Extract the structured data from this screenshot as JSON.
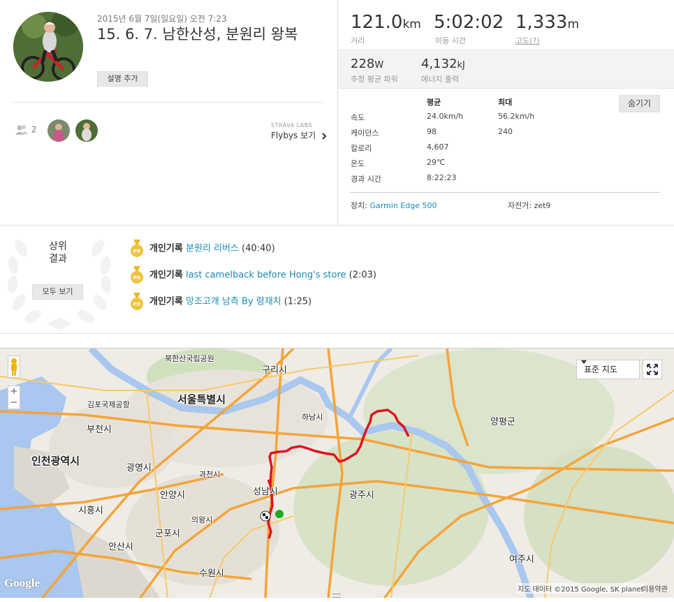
{
  "activity": {
    "date": "2015년 6월 7일(일요일) 오전 7:23",
    "title": "15. 6. 7. 남한산성, 분원리 왕복",
    "add_description": "설명 추가",
    "kudos_count": "2",
    "flybys_lab": "STRAVA LABS",
    "flybys_label": "Flybys 보기"
  },
  "stats": {
    "distance_value": "121.0",
    "distance_unit": "km",
    "distance_label": "거리",
    "moving_time_value": "5:02:02",
    "moving_time_label": "이동 시간",
    "elevation_value": "1,333",
    "elevation_unit": "m",
    "elevation_label": "고도(?)",
    "power_value": "228",
    "power_unit": "W",
    "power_label": "추정 평균 파워",
    "energy_value": "4,132",
    "energy_unit": "kJ",
    "energy_label": "에너지 출력"
  },
  "details": {
    "col_avg": "평균",
    "col_max": "최대",
    "hide_button": "숨기기",
    "rows": [
      {
        "label": "속도",
        "avg": "24.0km/h",
        "max": "56.2km/h"
      },
      {
        "label": "케이던스",
        "avg": "98",
        "max": "240"
      },
      {
        "label": "칼로리",
        "avg": "4,607",
        "max": ""
      },
      {
        "label": "온도",
        "avg": "29℃",
        "max": ""
      },
      {
        "label": "경과 시간",
        "avg": "8:22:23",
        "max": ""
      }
    ],
    "device_label": "장치:",
    "device_value": "Garmin Edge 500",
    "bike_label": "자전거:",
    "bike_value": "zet9"
  },
  "results": {
    "heading_line1": "상위",
    "heading_line2": "결과",
    "see_all": "모두 보기",
    "items": [
      {
        "badge": "PR",
        "prefix": "개인기록",
        "segment": "분원리 리버스",
        "time": "(40:40)"
      },
      {
        "badge": "PR",
        "prefix": "개인기록",
        "segment": "last camelback before Hong's store",
        "time": "(2:03)"
      },
      {
        "badge": "PR",
        "prefix": "개인기록",
        "segment": "망조고개 남측 By 령재치",
        "time": "(1:25)"
      }
    ]
  },
  "map": {
    "map_type": "표준 지도",
    "zoom_in": "+",
    "zoom_out": "−",
    "logo": "Google",
    "copyright": "지도 데이터 ©2015 Google, SK planet",
    "terms": "이용약관",
    "labels": {
      "park": "북한산국립공원",
      "guri": "구리시",
      "seoul": "서울특별시",
      "gimpo": "김포국제공항",
      "bucheon": "부천시",
      "incheon": "인천광역시",
      "hanam": "하남시",
      "yangpyeong": "양평군",
      "gwangmyeong": "광명시",
      "gwacheon": "과천시",
      "seongnam": "성남시",
      "gwangju": "광주시",
      "anyang": "안양시",
      "siheung": "시흥시",
      "uiwang": "의왕시",
      "gunpo": "군포시",
      "ansan": "안산시",
      "suwon": "수원시",
      "yeoju": "여주시"
    },
    "route_color": "#e0141e",
    "start_color": "#22aa22"
  }
}
